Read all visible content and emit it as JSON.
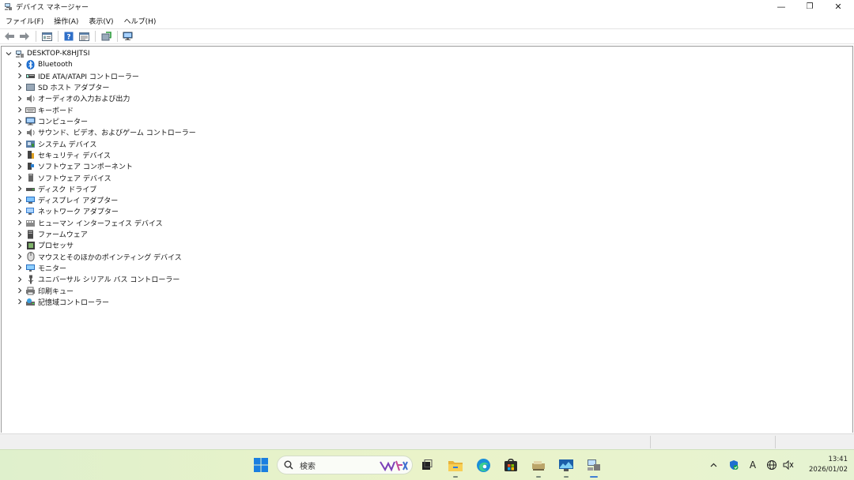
{
  "window": {
    "title": "デバイス マネージャー",
    "controls": {
      "minimize": "—",
      "maximize": "❐",
      "close": "✕"
    }
  },
  "menu": [
    "ファイル(F)",
    "操作(A)",
    "表示(V)",
    "ヘルプ(H)"
  ],
  "toolbar": {
    "buttons": [
      "back-arrow-icon",
      "forward-arrow-icon",
      "properties-icon",
      "help-icon",
      "details-icon",
      "update-driver-icon",
      "scan-hardware-icon"
    ]
  },
  "tree": {
    "root": {
      "label": "DESKTOP-K8HJTSI",
      "icon": "computer-icon",
      "expanded": true
    },
    "categories": [
      {
        "label": "Bluetooth",
        "icon": "bluetooth-icon"
      },
      {
        "label": "IDE ATA/ATAPI コントローラー",
        "icon": "ide-controller-icon"
      },
      {
        "label": "SD ホスト アダプター",
        "icon": "sd-host-icon"
      },
      {
        "label": "オーディオの入力および出力",
        "icon": "audio-io-icon"
      },
      {
        "label": "キーボード",
        "icon": "keyboard-icon"
      },
      {
        "label": "コンピューター",
        "icon": "computer-icon"
      },
      {
        "label": "サウンド、ビデオ、およびゲーム コントローラー",
        "icon": "sound-video-icon"
      },
      {
        "label": "システム デバイス",
        "icon": "system-device-icon"
      },
      {
        "label": "セキュリティ デバイス",
        "icon": "security-device-icon"
      },
      {
        "label": "ソフトウェア コンポーネント",
        "icon": "software-component-icon"
      },
      {
        "label": "ソフトウェア デバイス",
        "icon": "software-device-icon"
      },
      {
        "label": "ディスク ドライブ",
        "icon": "disk-drive-icon"
      },
      {
        "label": "ディスプレイ アダプター",
        "icon": "display-adapter-icon"
      },
      {
        "label": "ネットワーク アダプター",
        "icon": "network-adapter-icon"
      },
      {
        "label": "ヒューマン インターフェイス デバイス",
        "icon": "hid-icon"
      },
      {
        "label": "ファームウェア",
        "icon": "firmware-icon"
      },
      {
        "label": "プロセッサ",
        "icon": "processor-icon"
      },
      {
        "label": "マウスとそのほかのポインティング デバイス",
        "icon": "mouse-icon"
      },
      {
        "label": "モニター",
        "icon": "monitor-icon"
      },
      {
        "label": "ユニバーサル シリアル バス コントローラー",
        "icon": "usb-controller-icon"
      },
      {
        "label": "印刷キュー",
        "icon": "print-queue-icon"
      },
      {
        "label": "記憶域コントローラー",
        "icon": "storage-controller-icon"
      }
    ]
  },
  "taskbar": {
    "search_placeholder": "検索",
    "apps": [
      "start-icon",
      "task-view-icon",
      "file-explorer-icon",
      "edge-icon",
      "store-icon",
      "app-icon-1",
      "app-icon-2",
      "device-manager-icon"
    ],
    "tray": [
      "chevron-up-icon",
      "defender-icon",
      "ime-icon",
      "network-icon",
      "volume-icon"
    ],
    "ime_label": "A",
    "time": "13:41",
    "date": "2026/01/02"
  },
  "colors": {
    "taskbar_bg": "#e6f2cf",
    "accent": "#0a64d8"
  }
}
